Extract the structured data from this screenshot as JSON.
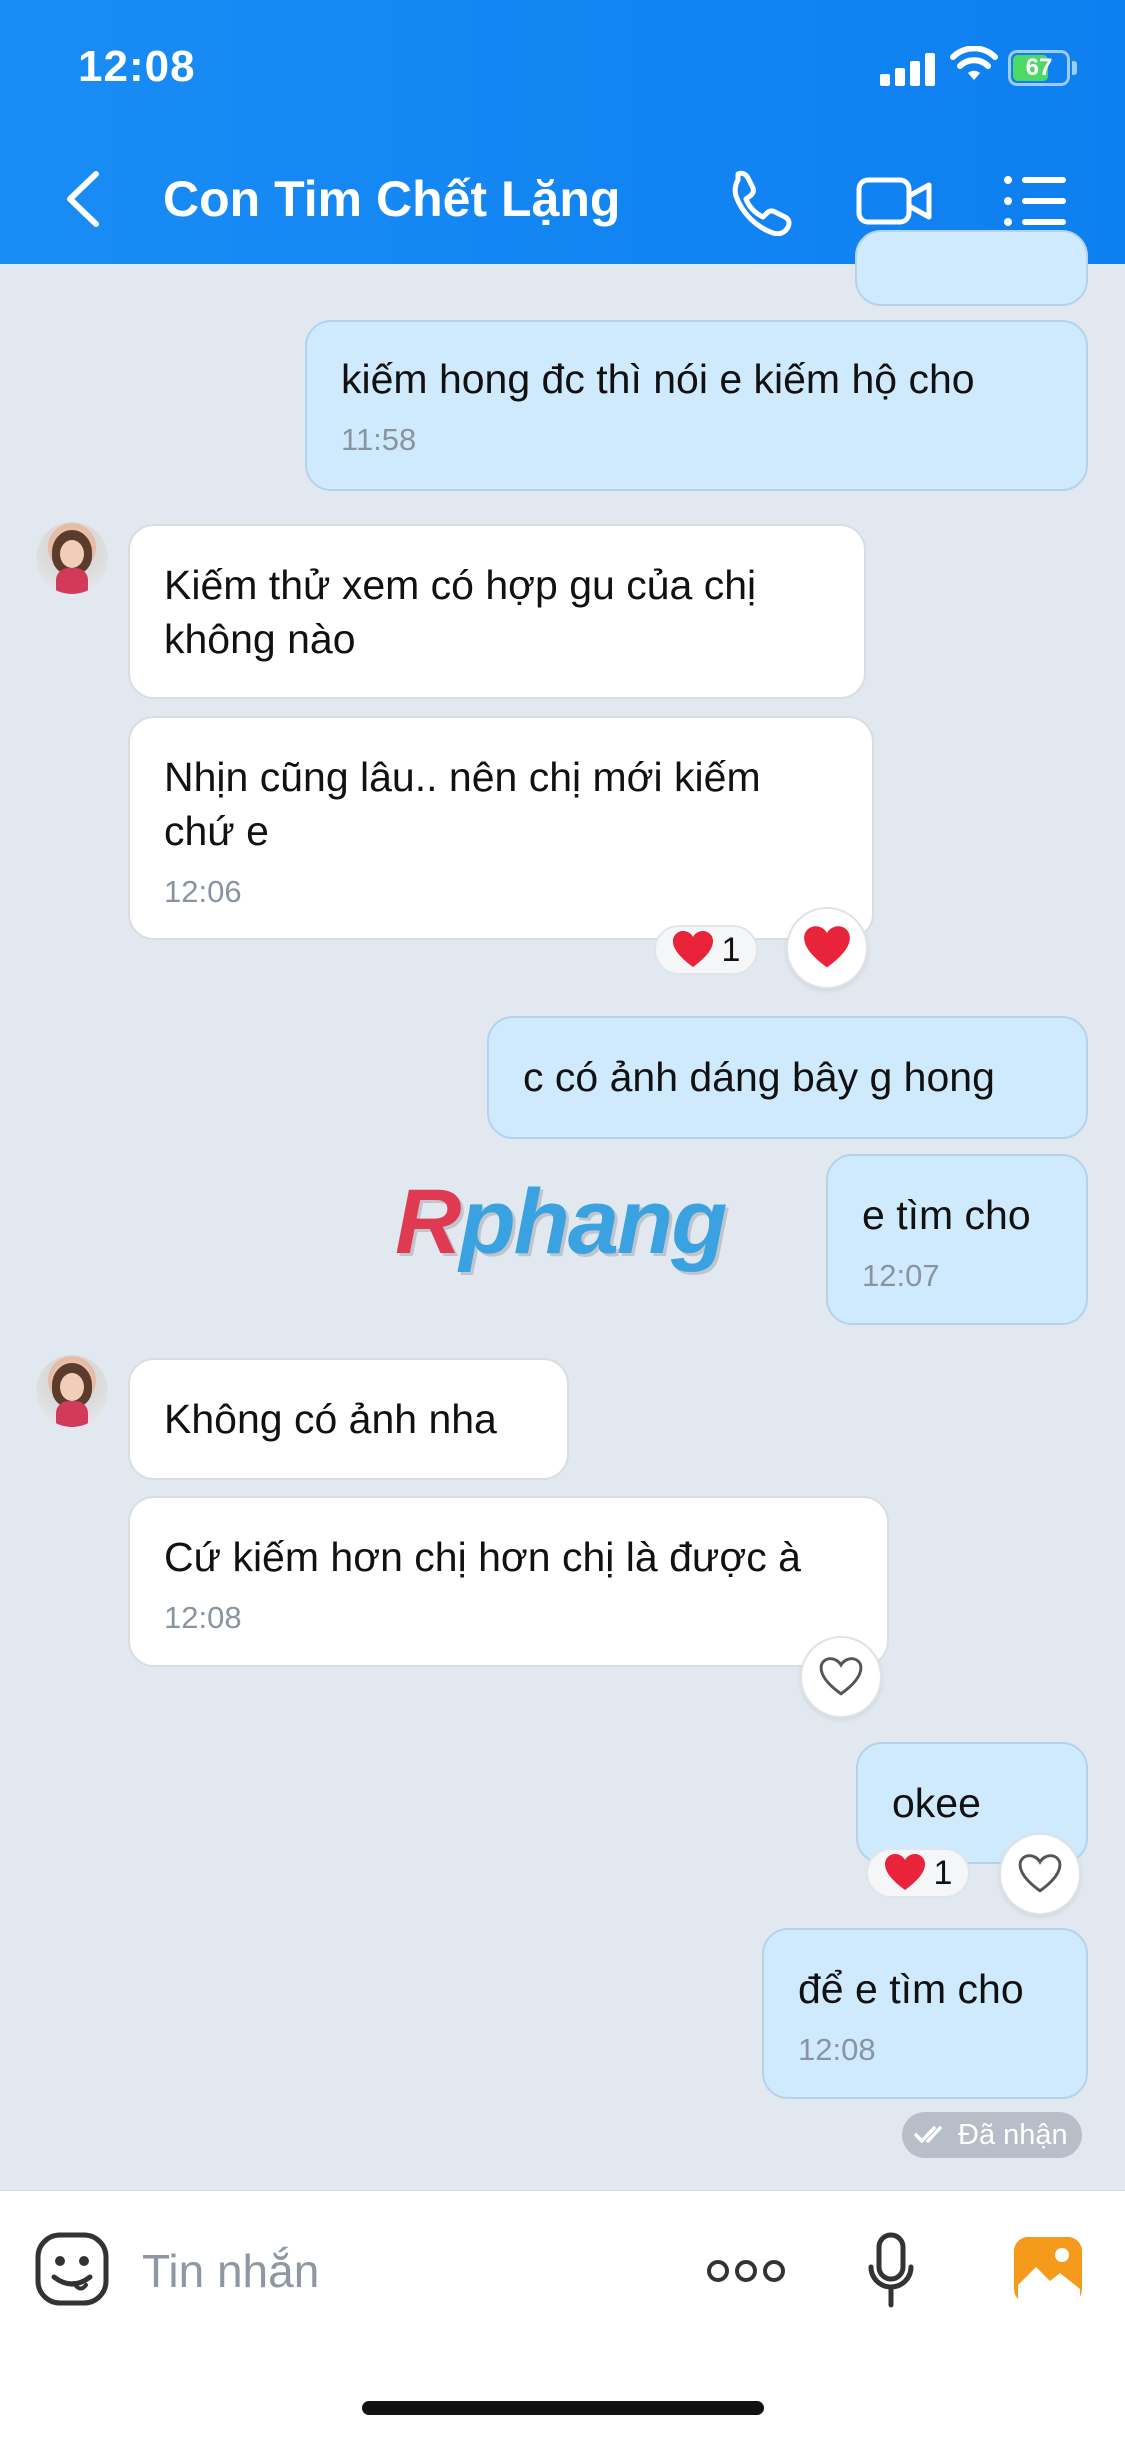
{
  "status_bar": {
    "time": "12:08",
    "battery": "67",
    "battery_level": 0.67
  },
  "header": {
    "title": "Con Tim Chết Lặng",
    "icons": [
      "back-icon",
      "phone-icon",
      "video-icon",
      "menu-list-icon"
    ]
  },
  "colors": {
    "header": "#1a8cf5",
    "outgoing_bubble": "#cfeafc",
    "incoming_bubble": "#ffffff",
    "background": "#e2e8f0",
    "heart": "#e8233a"
  },
  "messages": [
    {
      "direction": "out",
      "text": "kiếm hong đc thì nói e kiếm hộ cho",
      "time": "11:58"
    },
    {
      "direction": "in",
      "text": "Kiếm thử xem có hợp gu của chị không nào",
      "time": ""
    },
    {
      "direction": "in",
      "text": "Nhịn cũng lâu.. nên chị mới kiếm chứ e",
      "time": "12:06",
      "reaction": {
        "emoji": "heart",
        "count": "1"
      }
    },
    {
      "direction": "out",
      "text": "c có ảnh dáng bây g hong",
      "time": ""
    },
    {
      "direction": "out",
      "text": "e tìm cho",
      "time": "12:07"
    },
    {
      "direction": "in",
      "text": "Không có ảnh nha",
      "time": ""
    },
    {
      "direction": "in",
      "text": "Cứ kiếm hơn chị hơn chị là được à",
      "time": "12:08"
    },
    {
      "direction": "out",
      "text": "okee",
      "time": "",
      "reaction": {
        "emoji": "heart",
        "count": "1"
      }
    },
    {
      "direction": "out",
      "text": "để e tìm cho",
      "time": "12:08"
    }
  ],
  "watermark": {
    "first": "R",
    "rest": "phang"
  },
  "receipt": "Đã nhận",
  "composer": {
    "placeholder": "Tin nhắn",
    "value": ""
  }
}
